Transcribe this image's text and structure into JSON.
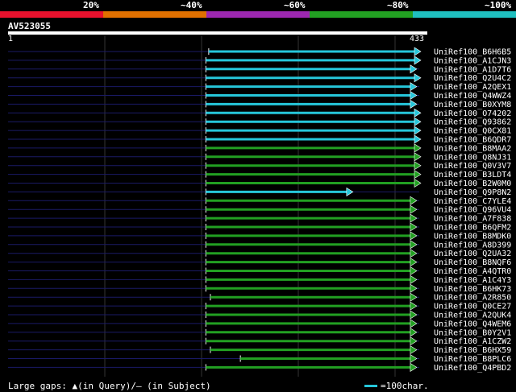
{
  "scale": {
    "segments": [
      {
        "color": "#e8112d"
      },
      {
        "color": "#e07000"
      },
      {
        "color": "#9c27b0"
      },
      {
        "color": "#22a022"
      },
      {
        "color": "#1fbfbf"
      }
    ],
    "labels": [
      "20%",
      "~40%",
      "~60%",
      "~80%",
      "~100%"
    ]
  },
  "query": {
    "id": "AV523055",
    "start": "1",
    "end": "433"
  },
  "hits": [
    {
      "id": "UniRef100_B6H6B5",
      "color": "#26c6da",
      "start": 0.488,
      "end": 1.0,
      "arrow_end": 1.0
    },
    {
      "id": "UniRef100_A1CJN3",
      "color": "#26c6da",
      "start": 0.481,
      "end": 1.0,
      "arrow_end": 1.0
    },
    {
      "id": "UniRef100_A1D7T6",
      "color": "#26c6da",
      "start": 0.481,
      "end": 0.99,
      "arrow_end": 0.99
    },
    {
      "id": "UniRef100_Q2U4C2",
      "color": "#26c6da",
      "start": 0.481,
      "end": 1.0,
      "arrow_end": 1.0
    },
    {
      "id": "UniRef100_A2QEX1",
      "color": "#26c6da",
      "start": 0.481,
      "end": 0.99,
      "arrow_end": 0.99
    },
    {
      "id": "UniRef100_Q4WWZ4",
      "color": "#26c6da",
      "start": 0.481,
      "end": 0.99,
      "arrow_end": 0.99
    },
    {
      "id": "UniRef100_B0XYM8",
      "color": "#26c6da",
      "start": 0.481,
      "end": 0.99,
      "arrow_end": 0.99
    },
    {
      "id": "UniRef100_O74202",
      "color": "#26c6da",
      "start": 0.481,
      "end": 1.0,
      "arrow_end": 1.0
    },
    {
      "id": "UniRef100_Q93862",
      "color": "#26c6da",
      "start": 0.481,
      "end": 1.0,
      "arrow_end": 1.0
    },
    {
      "id": "UniRef100_Q0CX81",
      "color": "#26c6da",
      "start": 0.481,
      "end": 1.0,
      "arrow_end": 1.0
    },
    {
      "id": "UniRef100_B6QDR7",
      "color": "#26c6da",
      "start": 0.481,
      "end": 1.0,
      "arrow_end": 1.0
    },
    {
      "id": "UniRef100_B8MAA2",
      "color": "#22a022",
      "start": 0.481,
      "end": 1.0,
      "arrow_end": 1.0
    },
    {
      "id": "UniRef100_Q8NJ31",
      "color": "#22a022",
      "start": 0.481,
      "end": 1.0,
      "arrow_end": 1.0
    },
    {
      "id": "UniRef100_Q0V3V7",
      "color": "#22a022",
      "start": 0.481,
      "end": 1.0,
      "arrow_end": 1.0
    },
    {
      "id": "UniRef100_B3LDT4",
      "color": "#22a022",
      "start": 0.481,
      "end": 1.0,
      "arrow_end": 1.0
    },
    {
      "id": "UniRef100_B2W0M0",
      "color": "#22a022",
      "start": 0.481,
      "end": 1.0,
      "arrow_end": 1.0
    },
    {
      "id": "UniRef100_Q9P8N2",
      "color": "#26c6da",
      "start": 0.481,
      "end": 0.835,
      "arrow_end": 0.835
    },
    {
      "id": "UniRef100_C7YLE4",
      "color": "#22a022",
      "start": 0.481,
      "end": 0.99,
      "arrow_end": 0.99
    },
    {
      "id": "UniRef100_Q96VU4",
      "color": "#22a022",
      "start": 0.481,
      "end": 0.99,
      "arrow_end": 0.99
    },
    {
      "id": "UniRef100_A7F838",
      "color": "#22a022",
      "start": 0.481,
      "end": 0.99,
      "arrow_end": 0.99
    },
    {
      "id": "UniRef100_B6QFM2",
      "color": "#22a022",
      "start": 0.481,
      "end": 0.99,
      "arrow_end": 0.99
    },
    {
      "id": "UniRef100_B8MDK0",
      "color": "#22a022",
      "start": 0.481,
      "end": 0.99,
      "arrow_end": 0.99
    },
    {
      "id": "UniRef100_A8D399",
      "color": "#22a022",
      "start": 0.481,
      "end": 0.99,
      "arrow_end": 0.99
    },
    {
      "id": "UniRef100_Q2UA32",
      "color": "#22a022",
      "start": 0.481,
      "end": 0.99,
      "arrow_end": 0.99
    },
    {
      "id": "UniRef100_B8NQF6",
      "color": "#22a022",
      "start": 0.481,
      "end": 0.99,
      "arrow_end": 0.99
    },
    {
      "id": "UniRef100_A4QTR0",
      "color": "#22a022",
      "start": 0.481,
      "end": 0.99,
      "arrow_end": 0.99
    },
    {
      "id": "UniRef100_A1C4Y3",
      "color": "#22a022",
      "start": 0.481,
      "end": 0.99,
      "arrow_end": 0.99
    },
    {
      "id": "UniRef100_B6HK73",
      "color": "#22a022",
      "start": 0.481,
      "end": 0.99,
      "arrow_end": 0.99
    },
    {
      "id": "UniRef100_A2R850",
      "color": "#22a022",
      "start": 0.492,
      "end": 0.99,
      "arrow_end": 0.99
    },
    {
      "id": "UniRef100_Q0CE27",
      "color": "#22a022",
      "start": 0.481,
      "end": 0.99,
      "arrow_end": 0.99
    },
    {
      "id": "UniRef100_A2QUK4",
      "color": "#22a022",
      "start": 0.481,
      "end": 0.99,
      "arrow_end": 0.99
    },
    {
      "id": "UniRef100_Q4WEM6",
      "color": "#22a022",
      "start": 0.481,
      "end": 0.99,
      "arrow_end": 0.99
    },
    {
      "id": "UniRef100_B0Y2V1",
      "color": "#22a022",
      "start": 0.481,
      "end": 0.99,
      "arrow_end": 0.99
    },
    {
      "id": "UniRef100_A1CZW2",
      "color": "#22a022",
      "start": 0.481,
      "end": 0.99,
      "arrow_end": 0.99
    },
    {
      "id": "UniRef100_B6HX59",
      "color": "#22a022",
      "start": 0.492,
      "end": 0.99,
      "arrow_end": 0.99
    },
    {
      "id": "UniRef100_B8PLC6",
      "color": "#22a022",
      "start": 0.565,
      "end": 0.99,
      "arrow_end": 0.99
    },
    {
      "id": "UniRef100_Q4PBD2",
      "color": "#22a022",
      "start": 0.481,
      "end": 0.99,
      "arrow_end": 0.99
    }
  ],
  "legend": {
    "gaps_text": "Large gaps: ▲(in Query)/– (in Subject)",
    "scale_text": "=100char."
  }
}
